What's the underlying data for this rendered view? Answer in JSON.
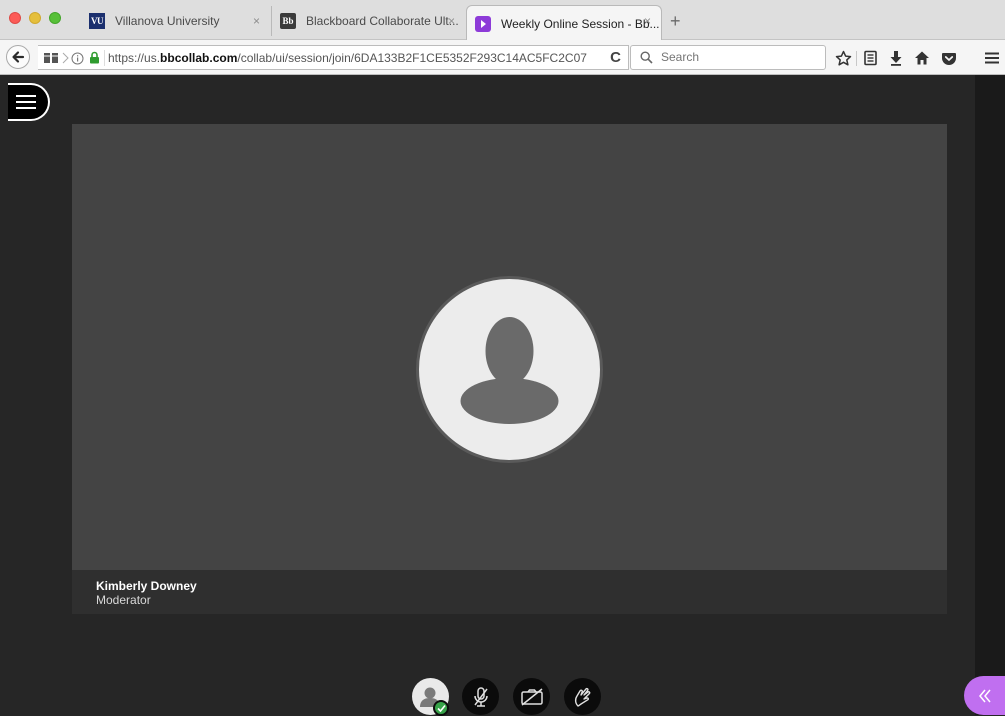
{
  "browser": {
    "tabs": [
      {
        "title": "Villanova University",
        "favicon_text": "VU",
        "close": "×",
        "active": false
      },
      {
        "title": "Blackboard Collaborate Ult...",
        "favicon_text": "Bb",
        "close": "×",
        "active": false
      },
      {
        "title": "Weekly Online Session - Bb...",
        "favicon_text": "",
        "close": "×",
        "active": true
      }
    ],
    "new_tab": "+",
    "url": {
      "prefix": "https://us.",
      "domain": "bbcollab.com",
      "path": "/collab/ui/session/join/6DA133B2F1CE5352F293C14AC5FC2C07"
    },
    "reload": "C",
    "search": {
      "placeholder": "Search",
      "value": ""
    }
  },
  "session": {
    "presenter": {
      "name": "Kimberly Downey",
      "role": "Moderator"
    }
  },
  "colors": {
    "stage": "#444444",
    "background": "#262626",
    "collab_toggle": "#c06ff0",
    "status_ok": "#37a349"
  }
}
